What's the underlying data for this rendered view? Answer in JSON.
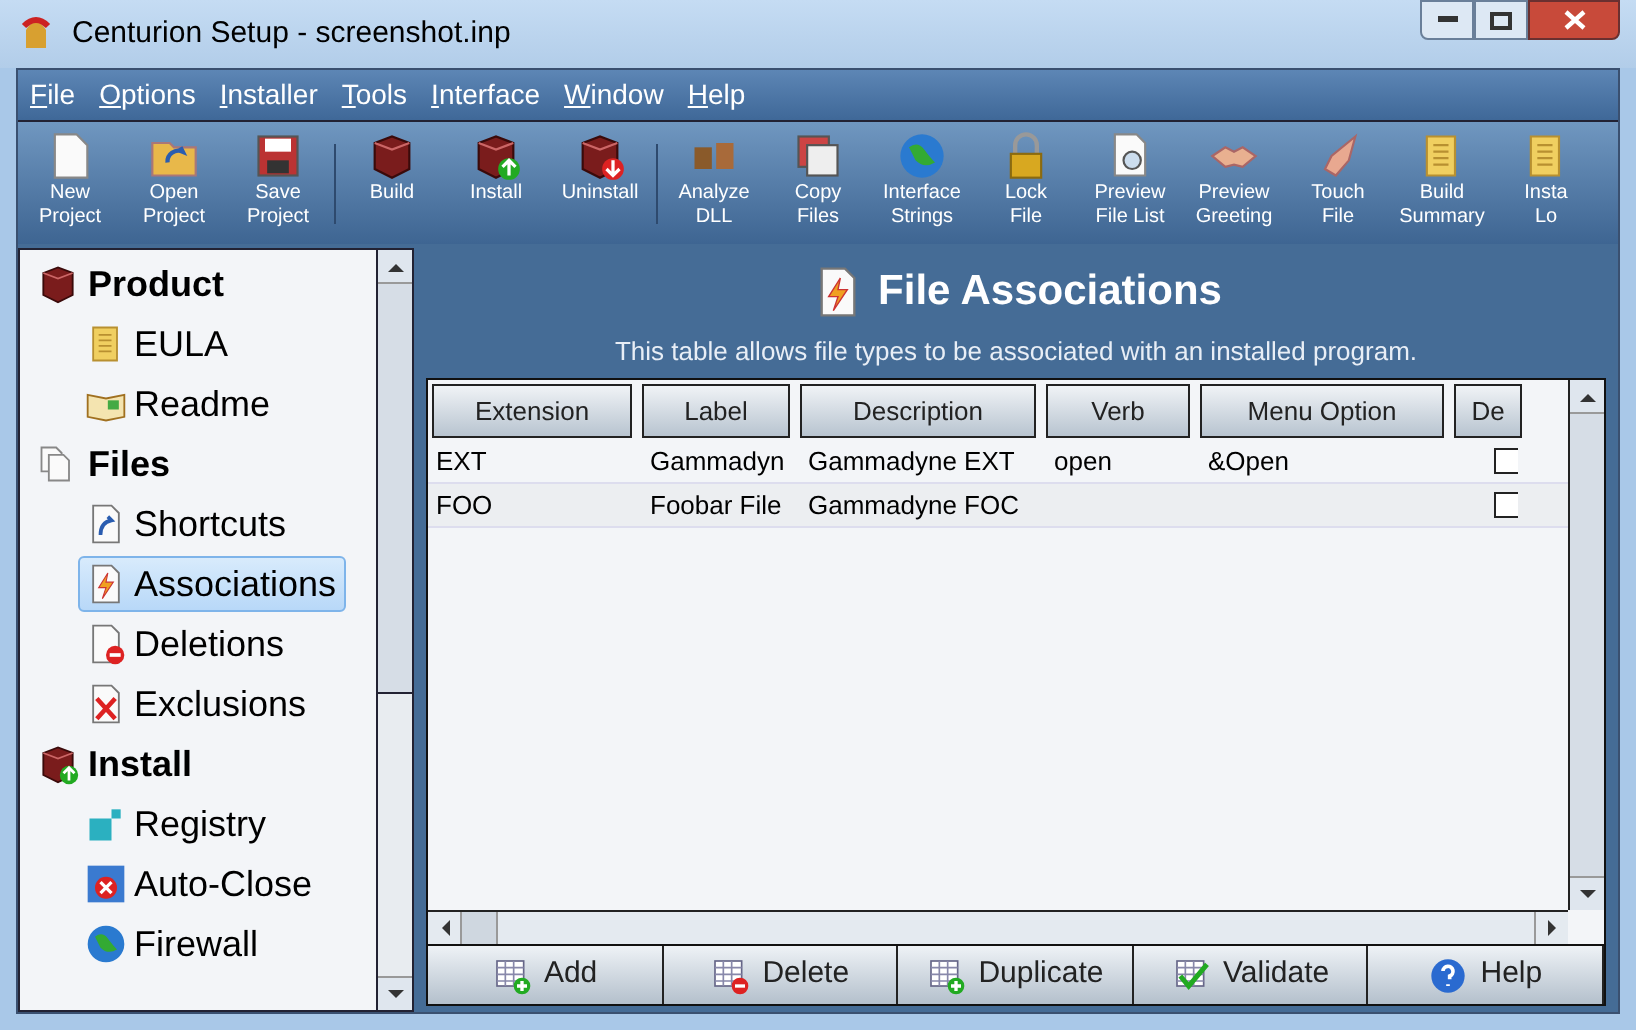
{
  "window": {
    "title": "Centurion Setup - screenshot.inp"
  },
  "menu": [
    "File",
    "Options",
    "Installer",
    "Tools",
    "Interface",
    "Window",
    "Help"
  ],
  "toolbar": [
    {
      "lines": [
        "New",
        "Project"
      ]
    },
    {
      "lines": [
        "Open",
        "Project"
      ]
    },
    {
      "lines": [
        "Save",
        "Project"
      ]
    },
    {
      "lines": [
        "Build"
      ]
    },
    {
      "lines": [
        "Install"
      ]
    },
    {
      "lines": [
        "Uninstall"
      ]
    },
    {
      "lines": [
        "Analyze",
        "DLL"
      ]
    },
    {
      "lines": [
        "Copy",
        "Files"
      ]
    },
    {
      "lines": [
        "Interface",
        "Strings"
      ]
    },
    {
      "lines": [
        "Lock",
        "File"
      ]
    },
    {
      "lines": [
        "Preview",
        "File List"
      ]
    },
    {
      "lines": [
        "Preview",
        "Greeting"
      ]
    },
    {
      "lines": [
        "Touch",
        "File"
      ]
    },
    {
      "lines": [
        "Build",
        "Summary"
      ]
    },
    {
      "lines": [
        "Insta",
        "Lo"
      ]
    }
  ],
  "sidebar": {
    "items": [
      {
        "label": "Product",
        "children": [
          {
            "label": "EULA",
            "selected": false
          },
          {
            "label": "Readme",
            "selected": false
          }
        ]
      },
      {
        "label": "Files",
        "children": [
          {
            "label": "Shortcuts",
            "selected": false
          },
          {
            "label": "Associations",
            "selected": true
          },
          {
            "label": "Deletions",
            "selected": false
          },
          {
            "label": "Exclusions",
            "selected": false
          }
        ]
      },
      {
        "label": "Install",
        "children": [
          {
            "label": "Registry",
            "selected": false
          },
          {
            "label": "Auto-Close",
            "selected": false
          },
          {
            "label": "Firewall",
            "selected": false
          }
        ]
      }
    ]
  },
  "panel": {
    "title": "File Associations",
    "subtitle": "This table allows file types to be associated with an installed program."
  },
  "table": {
    "columns": [
      "Extension",
      "Label",
      "Description",
      "Verb",
      "Menu Option",
      "De"
    ],
    "rows": [
      {
        "cells": [
          "EXT",
          "Gammadyn",
          "Gammadyne EXT",
          "open",
          "&Open"
        ],
        "checked": false
      },
      {
        "cells": [
          "FOO",
          "Foobar File",
          "Gammadyne FOC",
          "",
          ""
        ],
        "checked": false
      }
    ]
  },
  "buttons": [
    {
      "label": "Add"
    },
    {
      "label": "Delete"
    },
    {
      "label": "Duplicate"
    },
    {
      "label": "Validate"
    },
    {
      "label": "Help"
    }
  ]
}
